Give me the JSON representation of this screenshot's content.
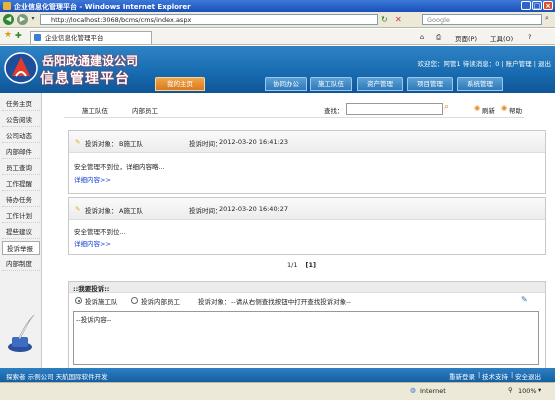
{
  "window": {
    "title": "企业信息化管理平台 - Windows Internet Explorer",
    "controls": [
      "_",
      "□",
      "×"
    ]
  },
  "browser": {
    "url": "http://localhost:3068/bcms/cms/index.aspx",
    "search_placeholder": "Google",
    "tab_label": "企业信息化管理平台",
    "page_menu": "页面(P)",
    "tools_menu": "工具(O)"
  },
  "header": {
    "brand_top": "岳阳政通建设公司",
    "brand_bottom": "信息管理平台",
    "welcome": "欢迎您：阿管1 待读消息：",
    "unread": "0",
    "account_link": "账户管理",
    "exit_link": "退出",
    "nav_tabs": [
      {
        "label": "我的主页",
        "active": true
      },
      {
        "label": "协同办公",
        "active": false
      },
      {
        "label": "施工队伍",
        "active": false
      },
      {
        "label": "资产管理",
        "active": false
      },
      {
        "label": "项目管理",
        "active": false
      },
      {
        "label": "系统管理",
        "active": false
      }
    ]
  },
  "sidebar": {
    "items": [
      {
        "label": "任务主页",
        "selected": false
      },
      {
        "label": "公告阅读",
        "selected": false
      },
      {
        "label": "公司动态",
        "selected": false
      },
      {
        "label": "内部邮件",
        "selected": false
      },
      {
        "label": "员工查询",
        "selected": false
      },
      {
        "label": "工作提醒",
        "selected": false
      },
      {
        "label": "待办任务",
        "selected": false
      },
      {
        "label": "工作计划",
        "selected": false
      },
      {
        "label": "提些建议",
        "selected": false
      },
      {
        "label": "投诉举报",
        "selected": true
      },
      {
        "label": "内部制度",
        "selected": false
      }
    ]
  },
  "main": {
    "tabs": [
      "施工队伍",
      "内部员工"
    ],
    "find_label": "查找：",
    "refresh": "刷新",
    "help": "帮助",
    "complaints": [
      {
        "target_label": "投诉对象：",
        "target": "B施工队",
        "time_label": "投诉时间：",
        "time": "2012-03-20 16:41:23",
        "body": "安全管理不到位，详细内容略...",
        "more": "详细内容>>"
      },
      {
        "target_label": "投诉对象：",
        "target": "A施工队",
        "time_label": "投诉时间：",
        "time": "2012-03-20 16:40:27",
        "body": "安全管理不到位...",
        "more": "详细内容>>"
      }
    ],
    "pager": {
      "total": "1/1",
      "current": "[1]"
    },
    "feedback": {
      "title": "::我要投诉::",
      "option_team": "投诉施工队",
      "option_staff": "投诉内部员工",
      "object_label": "投诉对象：",
      "object_hint": "--请从右侧查找按钮中打开查找投诉对象--",
      "content_placeholder": "--投诉内容--"
    }
  },
  "footer": {
    "left": "探索者 示例公司 天航国际软件开发",
    "links": [
      "重新登录",
      "技术支持",
      "安全退出"
    ]
  },
  "statusbar": {
    "zone": "Internet",
    "zoom": "100%"
  }
}
